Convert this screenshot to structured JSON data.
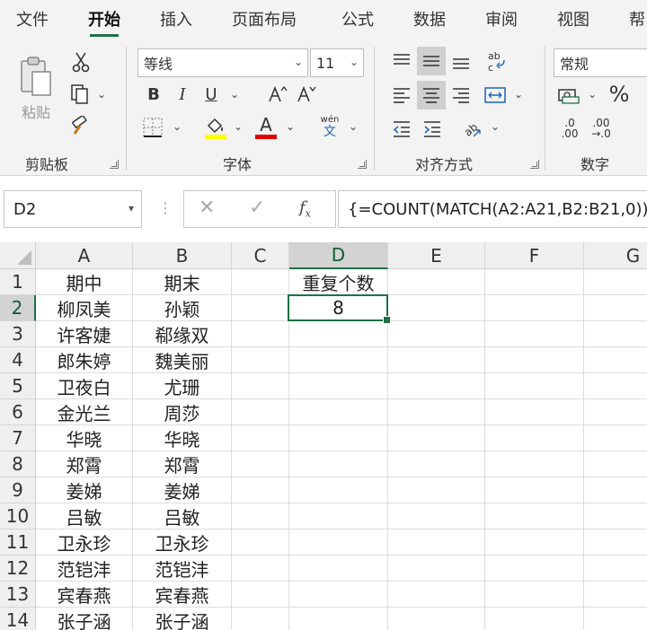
{
  "menu_tabs": [
    "文件",
    "开始",
    "插入",
    "页面布局",
    "公式",
    "数据",
    "审阅",
    "视图",
    "帮"
  ],
  "active_tab": "开始",
  "ribbon": {
    "groups": {
      "clipboard": "剪贴板",
      "font": "字体",
      "alignment": "对齐方式",
      "number": "数字"
    },
    "paste_label": "粘贴",
    "font_name": "等线",
    "font_size": "11",
    "bold": "B",
    "italic": "I",
    "underline": "U",
    "font_color_letter": "A",
    "phonetic_top": "wén",
    "phonetic_bottom": "文",
    "number_format": "常规",
    "percent": "%",
    "inc_decimal_top": ".0",
    "inc_decimal_bottom": ".00",
    "dec_decimal_top": ".00",
    "dec_decimal_bottom": "→.0"
  },
  "formula_bar": {
    "name_box": "D2",
    "formula": "{=COUNT(MATCH(A2:A21,B2:B21,0))}"
  },
  "sheet": {
    "columns": [
      "A",
      "B",
      "C",
      "D",
      "E",
      "F",
      "G"
    ],
    "selected_column": "D",
    "selected_row": 2,
    "rows": [
      {
        "n": "1",
        "A": "期中",
        "B": "期末",
        "D": "重复个数"
      },
      {
        "n": "2",
        "A": "柳凤美",
        "B": "孙颖",
        "D": "8"
      },
      {
        "n": "3",
        "A": "许客婕",
        "B": "郗缘双",
        "D": ""
      },
      {
        "n": "4",
        "A": "郎朱婷",
        "B": "魏美丽",
        "D": ""
      },
      {
        "n": "5",
        "A": "卫夜白",
        "B": "尤珊",
        "D": ""
      },
      {
        "n": "6",
        "A": "金光兰",
        "B": "周莎",
        "D": ""
      },
      {
        "n": "7",
        "A": "华晓",
        "B": "华晓",
        "D": ""
      },
      {
        "n": "8",
        "A": "郑霄",
        "B": "郑霄",
        "D": ""
      },
      {
        "n": "9",
        "A": "姜娣",
        "B": "姜娣",
        "D": ""
      },
      {
        "n": "10",
        "A": "吕敏",
        "B": "吕敏",
        "D": ""
      },
      {
        "n": "11",
        "A": "卫永珍",
        "B": "卫永珍",
        "D": ""
      },
      {
        "n": "12",
        "A": "范铠沣",
        "B": "范铠沣",
        "D": ""
      },
      {
        "n": "13",
        "A": "宾春燕",
        "B": "宾春燕",
        "D": ""
      },
      {
        "n": "14",
        "A": "张子涵",
        "B": "张子涵",
        "D": ""
      }
    ]
  },
  "colors": {
    "accent": "#1e7145",
    "ribbon_bg": "#f3f3f3",
    "header_bg": "#efefef",
    "font_highlight": "#ffff00",
    "font_color": "#e00000"
  }
}
